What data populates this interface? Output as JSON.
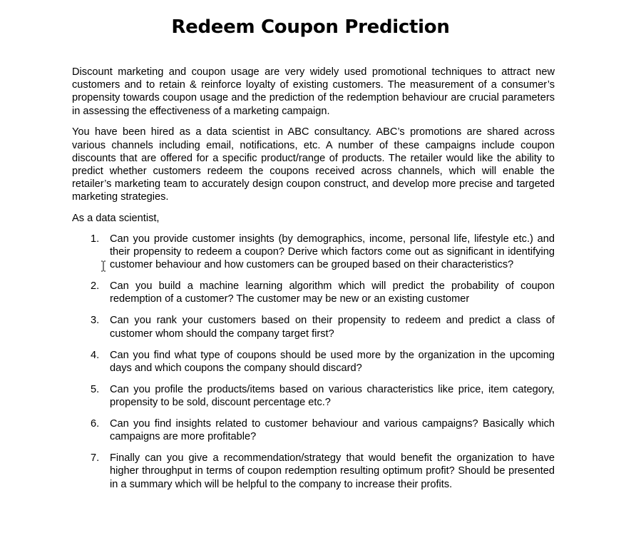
{
  "document": {
    "title": "Redeem Coupon Prediction",
    "paragraphs": [
      "Discount marketing and coupon usage are very widely used promotional techniques to attract new customers and to retain & reinforce loyalty of existing customers. The measurement of a consumer’s propensity towards coupon usage and the prediction of the redemption behaviour are crucial parameters in assessing the effectiveness of a marketing campaign.",
      "You have been hired as a data scientist in ABC consultancy. ABC’s promotions are shared across various channels including email, notifications, etc. A number of these campaigns include coupon discounts that are offered for a specific product/range of products. The retailer would like the ability to predict whether customers redeem the coupons received across channels, which will enable the retailer’s marketing team to accurately design coupon construct, and develop more precise and targeted marketing strategies."
    ],
    "intro": "As a data scientist,",
    "questions": [
      {
        "number": "1.",
        "text": "Can you provide customer insights (by demographics, income, personal life, lifestyle etc.) and their propensity to redeem a coupon? Derive which factors come out as significant in identifying customer behaviour and how customers can be grouped based on their characteristics?"
      },
      {
        "number": "2.",
        "text": "Can you build a machine learning algorithm which will predict the probability of coupon redemption of a customer? The customer may be new or an existing customer"
      },
      {
        "number": "3.",
        "text": "Can you rank your customers based on their propensity to redeem and predict a class of customer whom should the company target first?"
      },
      {
        "number": "4.",
        "text": "Can you find what type of coupons should be used more by the organization in the upcoming days and which coupons the company should discard?"
      },
      {
        "number": "5.",
        "text": "Can you profile the products/items based on various characteristics like price, item category, propensity to be sold, discount percentage etc.?"
      },
      {
        "number": "6.",
        "text": "Can you find insights related to customer behaviour and various campaigns? Basically which campaigns are more profitable?"
      },
      {
        "number": "7.",
        "text": "Finally can you give a recommendation/strategy that would benefit the organization to have higher throughput in terms of coupon redemption resulting optimum profit? Should be presented in a summary which will be helpful to the company to increase their profits."
      }
    ]
  },
  "icons": {
    "cursor": "text-cursor-icon"
  }
}
